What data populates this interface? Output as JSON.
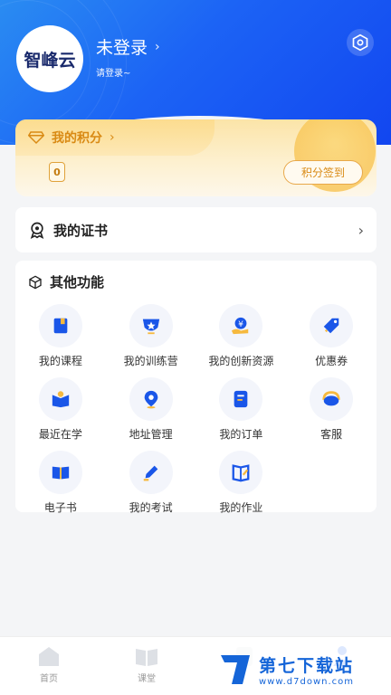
{
  "colors": {
    "primary": "#1c63f5",
    "gold": "#d98a14",
    "icon_blue": "#1a56e8"
  },
  "header": {
    "avatar_text": "智峰云",
    "username": "未登录",
    "subtext": "请登录~"
  },
  "points": {
    "title": "我的积分",
    "value": "0",
    "checkin_label": "积分签到"
  },
  "certificate": {
    "label": "我的证书"
  },
  "functions": {
    "title": "其他功能",
    "items": [
      {
        "label": "我的课程",
        "icon": "course-book-icon"
      },
      {
        "label": "我的训练营",
        "icon": "training-camp-icon"
      },
      {
        "label": "我的创新资源",
        "icon": "innovation-resource-icon"
      },
      {
        "label": "优惠券",
        "icon": "coupon-tag-icon"
      },
      {
        "label": "最近在学",
        "icon": "recent-study-icon"
      },
      {
        "label": "地址管理",
        "icon": "location-pin-icon"
      },
      {
        "label": "我的订单",
        "icon": "order-list-icon"
      },
      {
        "label": "客服",
        "icon": "customer-service-icon"
      },
      {
        "label": "电子书",
        "icon": "ebook-icon"
      },
      {
        "label": "我的考试",
        "icon": "exam-pen-icon"
      },
      {
        "label": "我的作业",
        "icon": "homework-icon"
      }
    ]
  },
  "tabbar": {
    "items": [
      {
        "label": "首页",
        "icon": "home-icon"
      },
      {
        "label": "课堂",
        "icon": "classroom-book-icon"
      },
      {
        "label": "",
        "icon": "study-icon"
      },
      {
        "label": "",
        "icon": "profile-icon"
      }
    ]
  },
  "watermark": {
    "main": "第七下载站",
    "sub": "www.d7down.com"
  }
}
